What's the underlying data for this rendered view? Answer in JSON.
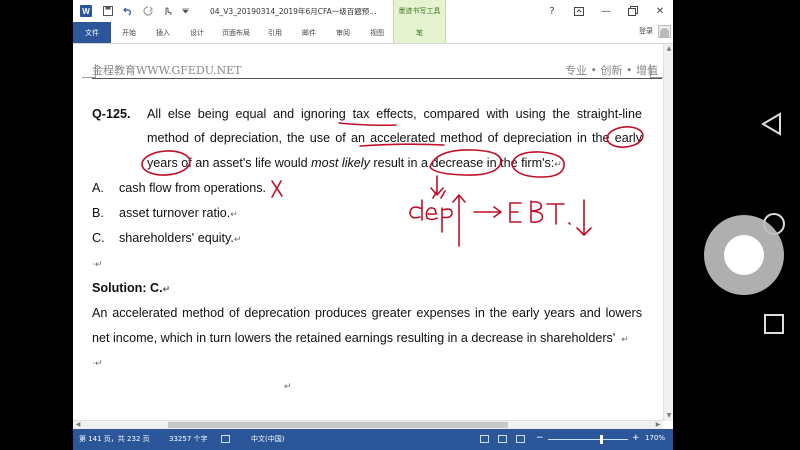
{
  "titlebar": {
    "app_icon": "W",
    "doc_title": "04_V3_20190314_2019年6月CFA一级百题预...",
    "context_tab_title": "墨迹书写工具",
    "help": "?",
    "restore": "□",
    "minimize": "—",
    "maximize": "▢",
    "close": "✕"
  },
  "ribbon": {
    "tabs": [
      "文件",
      "开始",
      "插入",
      "设计",
      "页面布局",
      "引用",
      "邮件",
      "审阅",
      "视图",
      "笔"
    ],
    "login": "登录"
  },
  "header": {
    "left": "金程教育WWW.GFEDU.NET",
    "right": "专业 • 创新 • 增值"
  },
  "question": {
    "number": "Q-125.",
    "line1": "All else being equal and ignoring tax effects, compared with using the straight-line",
    "line2": "method of depreciation, the use of an accelerated method of depreciation in the early",
    "line3_a": "years of an asset's life would ",
    "line3_em": "most likely",
    "line3_b": " result in a decrease in the firm's:",
    "options": [
      {
        "letter": "A.",
        "text": "cash flow from operations."
      },
      {
        "letter": "B.",
        "text": "asset turnover ratio."
      },
      {
        "letter": "C.",
        "text": "shareholders' equity."
      }
    ]
  },
  "solution": {
    "title": "Solution: C.",
    "line1": "An accelerated method of deprecation produces greater expenses in the early years and lowers",
    "line2": "net income, which in turn lowers the retained earnings resulting in a decrease in shareholders'"
  },
  "marks": {
    "para": "↵",
    "mark_inline": "⋅↵"
  },
  "handwriting": {
    "note": "dep↑ → EBT↓",
    "cross": "X",
    "ink_color": "#c0102a"
  },
  "status": {
    "page": "第 141 页，共 232 页",
    "words": "33257 个字",
    "language": "中文(中国)",
    "zoom": "170%"
  }
}
